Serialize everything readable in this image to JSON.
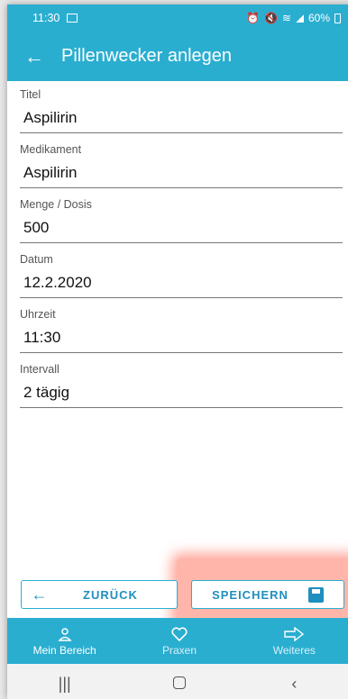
{
  "status": {
    "time": "11:30",
    "battery": "60%"
  },
  "appbar": {
    "back_icon": "arrow-left-icon",
    "title": "Pillenwecker anlegen"
  },
  "fields": [
    {
      "label": "Titel",
      "value": "Aspilirin"
    },
    {
      "label": "Medikament",
      "value": "Aspilirin"
    },
    {
      "label": "Menge / Dosis",
      "value": "500"
    },
    {
      "label": "Datum",
      "value": "12.2.2020"
    },
    {
      "label": "Uhrzeit",
      "value": "11:30"
    },
    {
      "label": "Intervall",
      "value": "2 tägig"
    }
  ],
  "buttons": {
    "back_label": "ZURÜCK",
    "save_label": "SPEICHERN"
  },
  "bottomnav": [
    {
      "label": "Mein Bereich",
      "icon": "person-icon",
      "active": true
    },
    {
      "label": "Praxen",
      "icon": "heart-icon",
      "active": false
    },
    {
      "label": "Weiteres",
      "icon": "arrow-right-outline-icon",
      "active": false
    }
  ],
  "colors": {
    "primary": "#2aaed0",
    "button_text": "#1f8fbf",
    "highlight": "#ff7864"
  }
}
